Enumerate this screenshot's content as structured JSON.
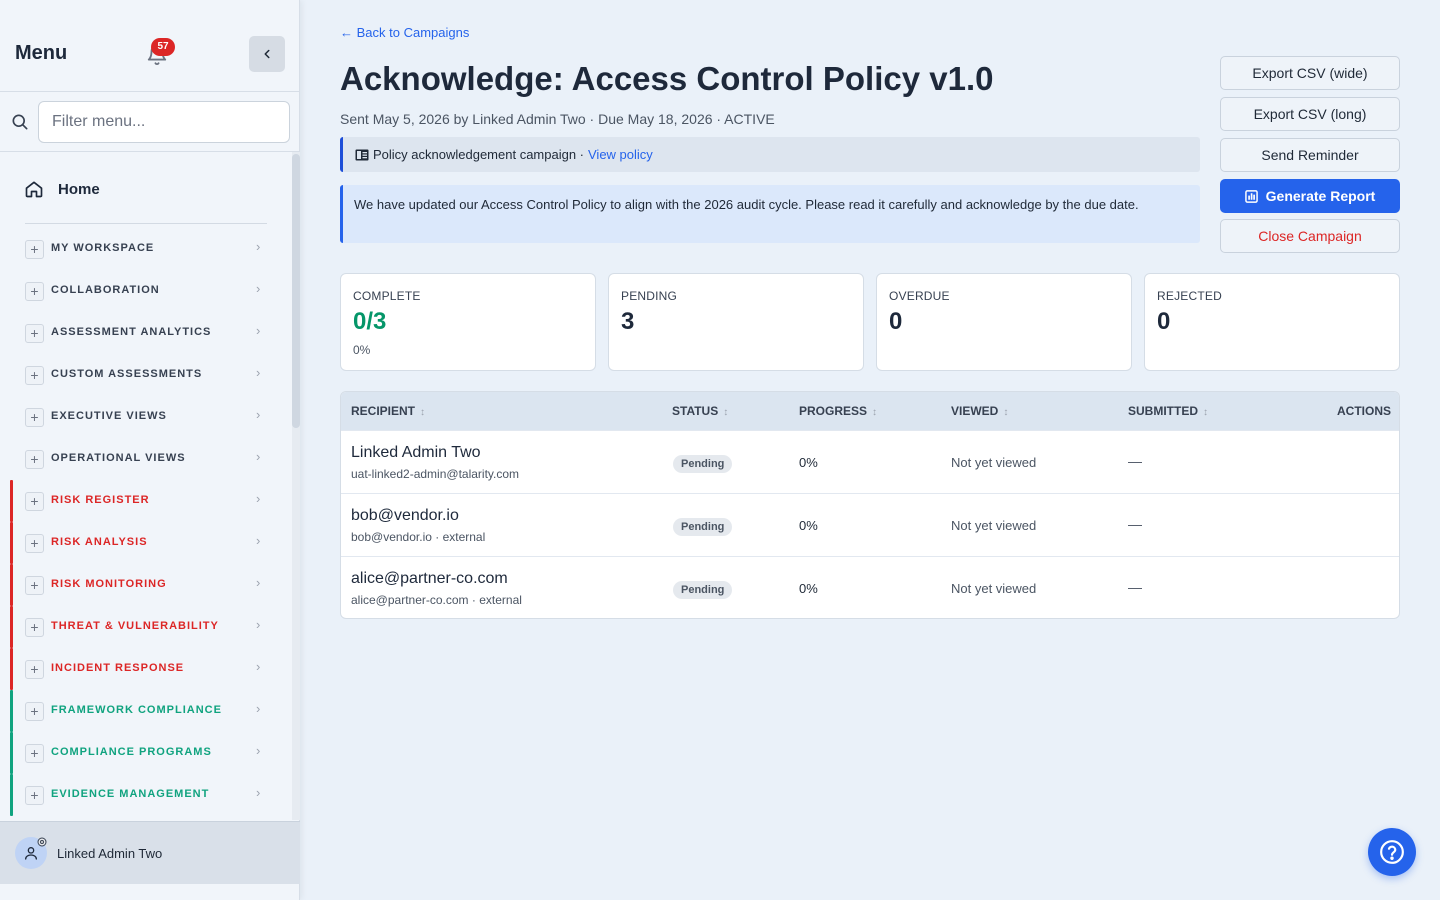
{
  "sidebar": {
    "title": "Menu",
    "notification_count": "57",
    "filter_placeholder": "Filter menu...",
    "home_label": "Home",
    "items": [
      {
        "label": "MY WORKSPACE",
        "group": "default"
      },
      {
        "label": "COLLABORATION",
        "group": "default"
      },
      {
        "label": "ASSESSMENT ANALYTICS",
        "group": "default"
      },
      {
        "label": "CUSTOM ASSESSMENTS",
        "group": "default"
      },
      {
        "label": "EXECUTIVE VIEWS",
        "group": "default"
      },
      {
        "label": "OPERATIONAL VIEWS",
        "group": "default"
      },
      {
        "label": "RISK REGISTER",
        "group": "risk"
      },
      {
        "label": "RISK ANALYSIS",
        "group": "risk"
      },
      {
        "label": "RISK MONITORING",
        "group": "risk"
      },
      {
        "label": "THREAT & VULNERABILITY",
        "group": "risk"
      },
      {
        "label": "INCIDENT RESPONSE",
        "group": "risk"
      },
      {
        "label": "FRAMEWORK COMPLIANCE",
        "group": "compliance"
      },
      {
        "label": "COMPLIANCE PROGRAMS",
        "group": "compliance"
      },
      {
        "label": "EVIDENCE MANAGEMENT",
        "group": "compliance"
      }
    ],
    "user_name": "Linked Admin Two"
  },
  "colors": {
    "default_text": "#374151",
    "risk": "#dc2626",
    "compliance": "#10a37f",
    "accent": "#2563eb"
  },
  "page": {
    "back_link": "← Back to Campaigns",
    "title": "Acknowledge: Access Control Policy v1.0",
    "meta": "Sent May 5, 2026 by Linked Admin Two · Due May 18, 2026 · ACTIVE",
    "info_text": "Policy acknowledgement campaign ·",
    "info_link": "View policy",
    "notice": "We have updated our Access Control Policy to align with the 2026 audit cycle. Please read it carefully and acknowledge by the due date."
  },
  "actions": {
    "export_wide": "Export CSV (wide)",
    "export_long": "Export CSV (long)",
    "send_reminder": "Send Reminder",
    "generate_report": "Generate Report",
    "close_campaign": "Close Campaign"
  },
  "stats": [
    {
      "label": "COMPLETE",
      "value": "0/3",
      "sub": "0%"
    },
    {
      "label": "PENDING",
      "value": "3",
      "sub": ""
    },
    {
      "label": "OVERDUE",
      "value": "0",
      "sub": ""
    },
    {
      "label": "REJECTED",
      "value": "0",
      "sub": ""
    }
  ],
  "table": {
    "columns": [
      "RECIPIENT",
      "STATUS",
      "PROGRESS",
      "VIEWED",
      "SUBMITTED",
      "ACTIONS"
    ],
    "rows": [
      {
        "name": "Linked Admin Two",
        "email": "uat-linked2-admin@talarity.com",
        "status": "Pending",
        "progress": "0%",
        "viewed": "Not yet viewed",
        "submitted": "—"
      },
      {
        "name": "bob@vendor.io",
        "email": "bob@vendor.io · external",
        "status": "Pending",
        "progress": "0%",
        "viewed": "Not yet viewed",
        "submitted": "—"
      },
      {
        "name": "alice@partner-co.com",
        "email": "alice@partner-co.com · external",
        "status": "Pending",
        "progress": "0%",
        "viewed": "Not yet viewed",
        "submitted": "—"
      }
    ]
  }
}
